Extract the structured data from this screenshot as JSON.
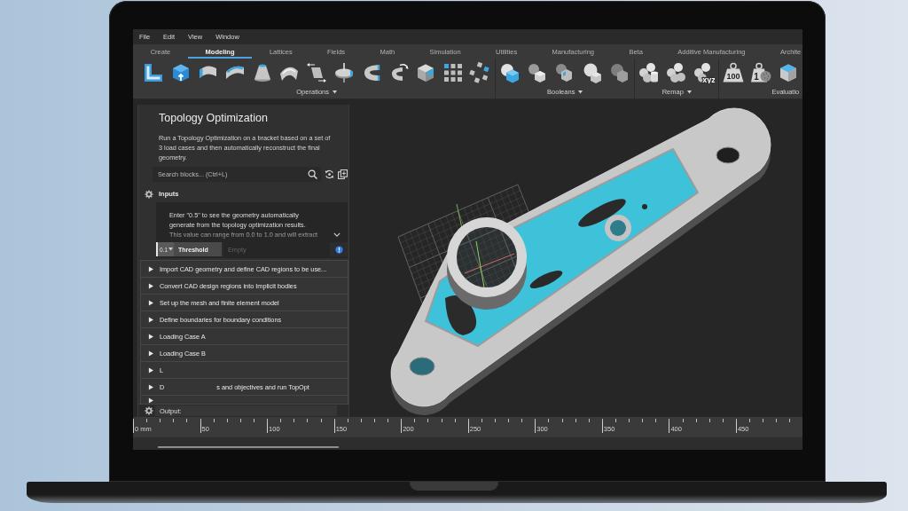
{
  "menu_bar": {
    "items": [
      "File",
      "Edit",
      "View",
      "Window"
    ]
  },
  "tabs": [
    {
      "label": "Create",
      "selected": false
    },
    {
      "label": "Modeling",
      "selected": true
    },
    {
      "label": "Lattices",
      "selected": false
    },
    {
      "label": "Fields",
      "selected": false
    },
    {
      "label": "Math",
      "selected": false
    },
    {
      "label": "Simulation",
      "selected": false
    },
    {
      "label": "Utilities",
      "selected": false
    },
    {
      "label": "Manufacturing",
      "selected": false
    },
    {
      "label": "Beta",
      "selected": false
    },
    {
      "label": "Additive Manufacturing",
      "selected": false
    },
    {
      "label": "Archite",
      "selected": false
    }
  ],
  "toolbar": {
    "groups": [
      {
        "label": "Operations",
        "dropdown": true
      },
      {
        "label": "Booleans",
        "dropdown": true
      },
      {
        "label": "Remap",
        "dropdown": true,
        "icon_texts": [
          "xyz"
        ]
      },
      {
        "label": "Evaluatio",
        "icon_texts": [
          "100",
          "1"
        ]
      }
    ]
  },
  "notebook": {
    "title": "Topology Optimization",
    "description": "Run a Topology Optimization on a bracket based on a set of\n3 load cases and then automatically reconstruct the final\ngeometry.",
    "search": {
      "placeholder": "Search blocks... (Ctrl+L)"
    },
    "inputs": {
      "label": "Inputs",
      "expanded": true,
      "note": "Enter \"0.5\" to see the geometry automatically\ngenerate from the topology optimization results.\nThis value can range from 0.0 to 1.0 and will extract",
      "field": {
        "type_label": "0.1",
        "label": "Threshold",
        "placeholder": "Empty"
      }
    },
    "sections": [
      {
        "label": "Import CAD geometry and define CAD regions to be use...",
        "expanded": false
      },
      {
        "label": "Convert CAD design regions into Implicit bodies",
        "expanded": false
      },
      {
        "label": "Set up the mesh and finite element model",
        "expanded": false
      },
      {
        "label": "Define boundaries for boundary conditions",
        "expanded": false
      },
      {
        "label": "Loading Case A",
        "expanded": false
      },
      {
        "label": "Loading Case B",
        "expanded": false
      },
      {
        "label": "L",
        "expanded": false
      },
      {
        "label": "D",
        "label_after": "s and objectives and run TopOpt",
        "expanded": false
      },
      {
        "expanded": false
      }
    ],
    "output": {
      "label": "Output:"
    }
  },
  "ruler": {
    "labels": [
      "0 mm",
      "50",
      "100",
      "150",
      "200",
      "250",
      "300",
      "350",
      "400",
      "450"
    ]
  }
}
